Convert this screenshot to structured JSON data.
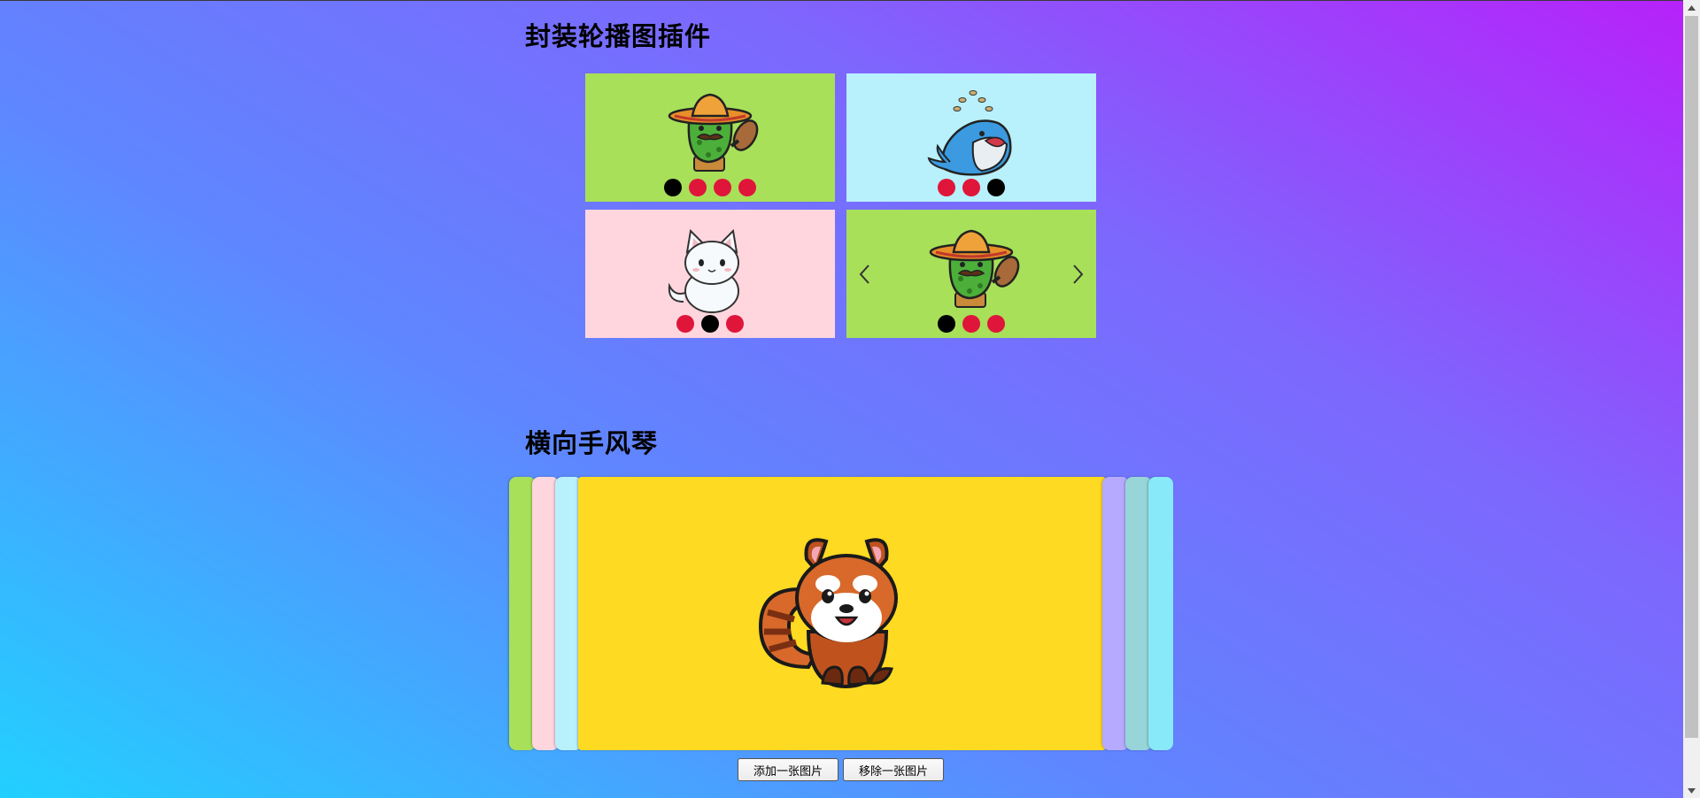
{
  "page": {
    "carousel_section_title": "封装轮播图插件",
    "accordion_section_title": "横向手风琴"
  },
  "carousels": [
    {
      "background": "#a8e059",
      "image": "cactus-sombrero-icon",
      "dots": 4,
      "active_dot": 1,
      "arrows": false
    },
    {
      "background": "#b8f0fb",
      "image": "whale-icon",
      "dots": 3,
      "active_dot": 3,
      "arrows": false
    },
    {
      "background": "#ffd6de",
      "image": "white-cat-icon",
      "dots": 3,
      "active_dot": 2,
      "arrows": false
    },
    {
      "background": "#a8e059",
      "image": "cactus-sombrero-icon",
      "dots": 3,
      "active_dot": 1,
      "arrows": true
    }
  ],
  "accordion": {
    "panels_left": [
      "#a8e059",
      "#ffd6de",
      "#b8f0fb"
    ],
    "active": {
      "background": "#ffda22",
      "image": "red-panda-icon"
    },
    "panels_right": [
      "#b6aaff",
      "#97d5d9",
      "#88e9f8"
    ]
  },
  "buttons": {
    "add_label": "添加一张图片",
    "remove_label": "移除一张图片"
  },
  "colors": {
    "dot_inactive": "#e0153a",
    "dot_active": "#000000"
  }
}
